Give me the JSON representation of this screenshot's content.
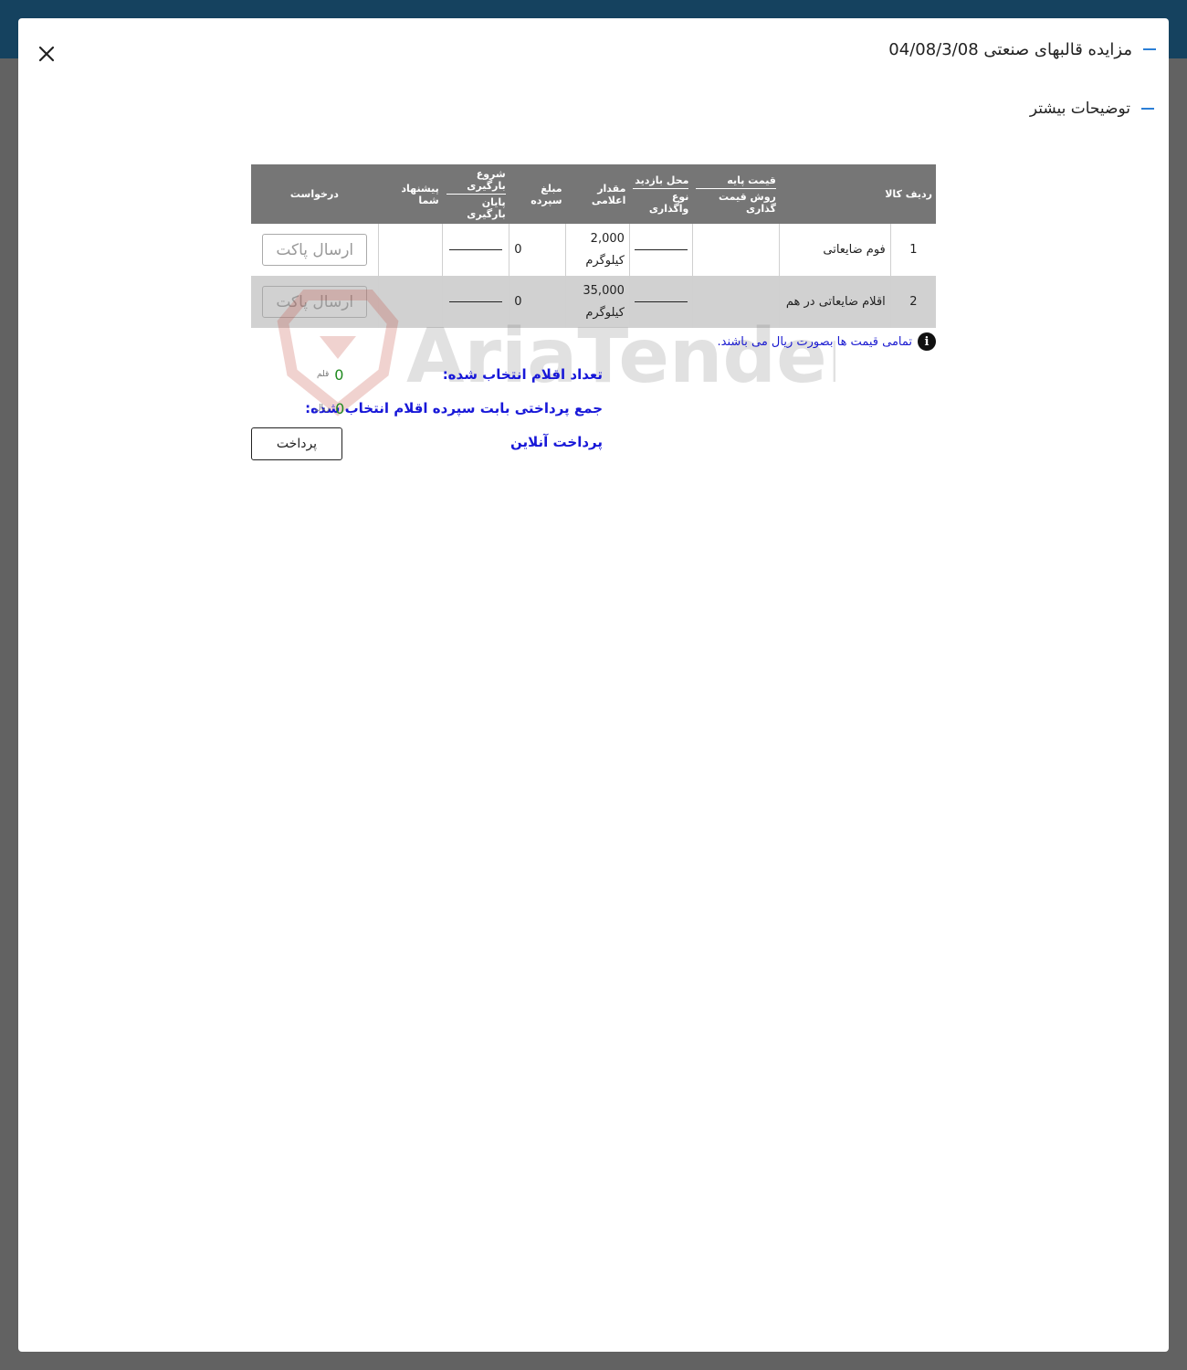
{
  "modal": {
    "title": "مزایده قالبهای صنعتی 04/08/3/08",
    "more_description": "توضیحات بیشتر"
  },
  "table": {
    "headers": {
      "row_item": "ردیف کالا",
      "base_price": "قیمت پایه",
      "pricing_method": "روش قیمت گذاری",
      "visit_place": "محل بازدید",
      "assignment_type": "نوع واگذاری",
      "declared_amount": "مقدار اعلامی",
      "deposit_amount": "مبلغ سپرده",
      "loading_start": "شروع بارگیری",
      "loading_end": "پایان بارگیری",
      "your_offer": "پیشنهاد شما",
      "request": "درخواست"
    },
    "rows": [
      {
        "index": "1",
        "name": "فوم ضایعاتی",
        "quantity": "2,000",
        "unit": "کیلوگرم",
        "deposit": "0",
        "action": "ارسال پاکت"
      },
      {
        "index": "2",
        "name": "اقلام ضایعاتی در هم",
        "quantity": "35,000",
        "unit": "کیلوگرم",
        "deposit": "0",
        "action": "ارسال پاکت"
      }
    ]
  },
  "notice": "تمامی قیمت ها بصورت ریال می باشند.",
  "watermark_text": "AriaTender.net",
  "summary": {
    "selected_count_label": "تعداد اقلام انتخاب شده:",
    "selected_count_value": "0",
    "selected_count_unit": "قلم",
    "total_label": "جمع پرداختی بابت سپرده اقلام انتخاب شده:",
    "total_value": "0",
    "total_unit": "ریال",
    "online_pay_label": "پرداخت آنلاین",
    "pay_button": "پرداخت"
  },
  "colors": {
    "topbar": "#15425f",
    "overlay": "#626262",
    "accent_dash": "#2b7fd6",
    "header_bg": "#767676",
    "summary_text": "#1818d8",
    "value_green": "#1f8a1f"
  }
}
